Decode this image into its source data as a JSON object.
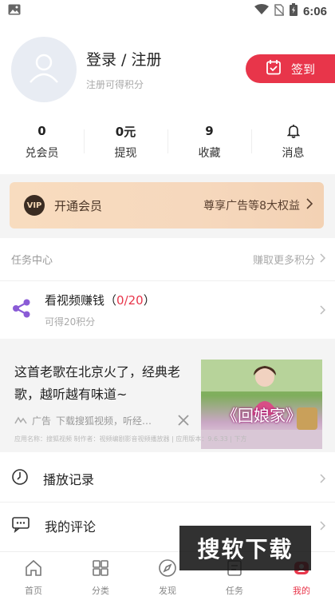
{
  "status_bar": {
    "time": "6:06"
  },
  "profile": {
    "title": "登录 / 注册",
    "subtitle": "注册可得积分",
    "signin_label": "签到"
  },
  "stats": [
    {
      "value": "0",
      "label": "兑会员"
    },
    {
      "value": "0元",
      "label": "提现"
    },
    {
      "value": "9",
      "label": "收藏"
    },
    {
      "value": "",
      "label": "消息",
      "icon": "bell-icon"
    }
  ],
  "vip": {
    "logo": "VIP",
    "title": "开通会员",
    "benefit": "尊享广告等8大权益"
  },
  "task_center": {
    "title": "任务中心",
    "more": "赚取更多积分",
    "task": {
      "name": "看视频赚钱",
      "progress": "0/20",
      "reward": "可得20积分"
    }
  },
  "ad": {
    "text": "这首老歌在北京火了，经典老歌，越听越有味道~",
    "image_title": "《回娘家》",
    "tag": "广告",
    "meta": "下载搜狐视频，听经…",
    "footer": "应用名称：搜狐视频 制作者：视频编剧影音视频播放器 | 应用版本：9.6.33 | 下方"
  },
  "menu": [
    {
      "label": "播放记录",
      "icon": "clock-icon"
    },
    {
      "label": "我的评论",
      "icon": "comment-icon"
    }
  ],
  "watermark": "搜软下载",
  "tabbar": [
    {
      "label": "首页",
      "icon": "home-icon"
    },
    {
      "label": "分类",
      "icon": "grid-icon"
    },
    {
      "label": "发现",
      "icon": "compass-icon"
    },
    {
      "label": "任务",
      "icon": "task-icon"
    },
    {
      "label": "我的",
      "icon": "profile-icon"
    }
  ],
  "colors": {
    "accent": "#e8354a",
    "vip_bg": "#f6d8bd",
    "band": "#f4f4f4"
  }
}
